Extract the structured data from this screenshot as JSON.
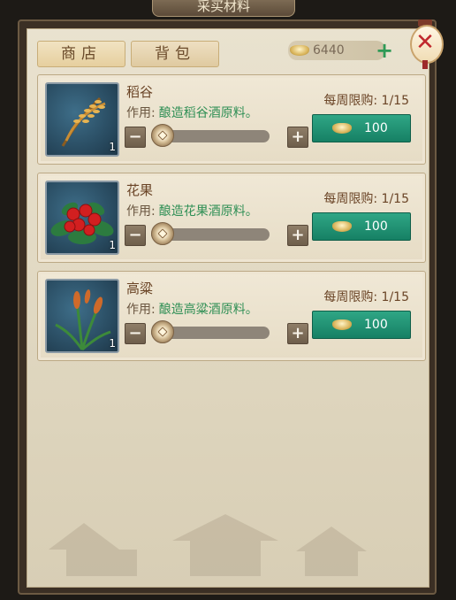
{
  "window": {
    "title": "采买材料",
    "close_icon": "close-lantern-icon"
  },
  "tabs": [
    {
      "label": "商店",
      "active": true
    },
    {
      "label": "背包",
      "active": false
    }
  ],
  "currency": {
    "icon": "gold-ingot-icon",
    "amount": "6440",
    "add_icon": "plus-icon"
  },
  "items": [
    {
      "name": "稻谷",
      "effect_label": "作用:",
      "effect_text": "酿造稻谷酒原料。",
      "limit": "每周限购: 1/15",
      "price": "100",
      "count": "1",
      "icon": "rice-grain-icon",
      "quantity_level": 0
    },
    {
      "name": "花果",
      "effect_label": "作用:",
      "effect_text": "酿造花果酒原料。",
      "limit": "每周限购: 1/15",
      "price": "100",
      "count": "1",
      "icon": "red-berries-icon",
      "quantity_level": 0
    },
    {
      "name": "高粱",
      "effect_label": "作用:",
      "effect_text": "酿造高粱酒原料。",
      "limit": "每周限购: 1/15",
      "price": "100",
      "count": "1",
      "icon": "sorghum-icon",
      "quantity_level": 0
    }
  ],
  "colors": {
    "panel": "#e9e2cf",
    "buy_button": "#1f8f70",
    "effect_text": "#2f8f55",
    "name_text": "#6a4426"
  }
}
